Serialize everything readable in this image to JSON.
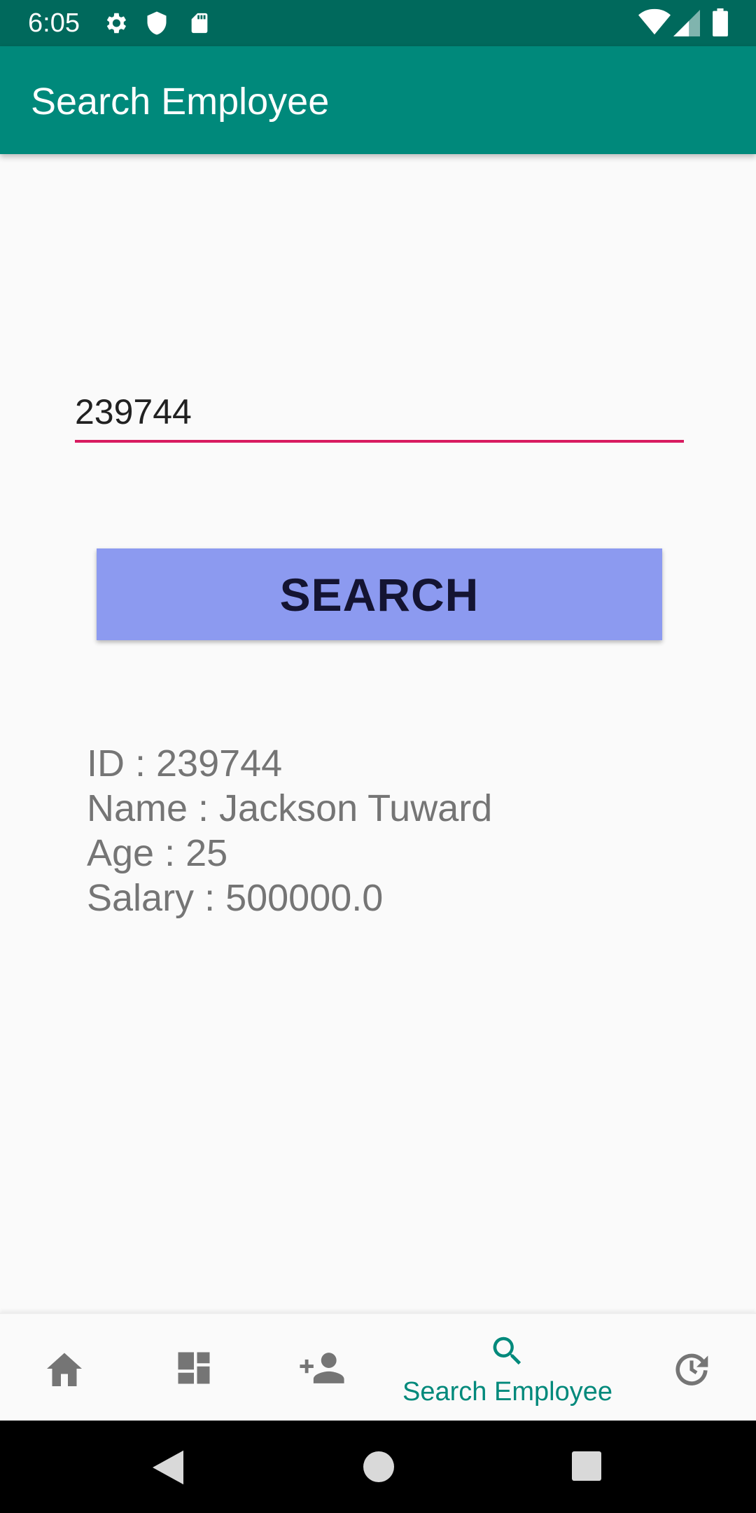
{
  "status_bar": {
    "time": "6:05",
    "left_icons": [
      "gear-icon",
      "shield-icon",
      "sd-card-icon"
    ],
    "right_icons": [
      "wifi-icon",
      "signal-icon",
      "battery-icon"
    ],
    "background": "#00695c"
  },
  "app_bar": {
    "title": "Search Employee",
    "background": "#00897b"
  },
  "search": {
    "value": "239744",
    "underline_color": "#d81b60",
    "button_label": "SEARCH",
    "button_color": "#8c9af0"
  },
  "result": {
    "id_line": "ID : 239744",
    "name_line": "Name : Jackson Tuward",
    "age_line": "Age : 25",
    "salary_line": "Salary : 500000.0"
  },
  "bottom_nav": {
    "items": [
      {
        "icon": "home-icon",
        "label": ""
      },
      {
        "icon": "dashboard-icon",
        "label": ""
      },
      {
        "icon": "add-person-icon",
        "label": ""
      },
      {
        "icon": "search-icon",
        "label": "Search Employee",
        "active": true
      },
      {
        "icon": "history-icon",
        "label": ""
      }
    ],
    "active_color": "#00897b",
    "inactive_color": "#757575"
  },
  "system_nav": {
    "buttons": [
      "back-icon",
      "home-circle-icon",
      "recents-icon"
    ]
  }
}
